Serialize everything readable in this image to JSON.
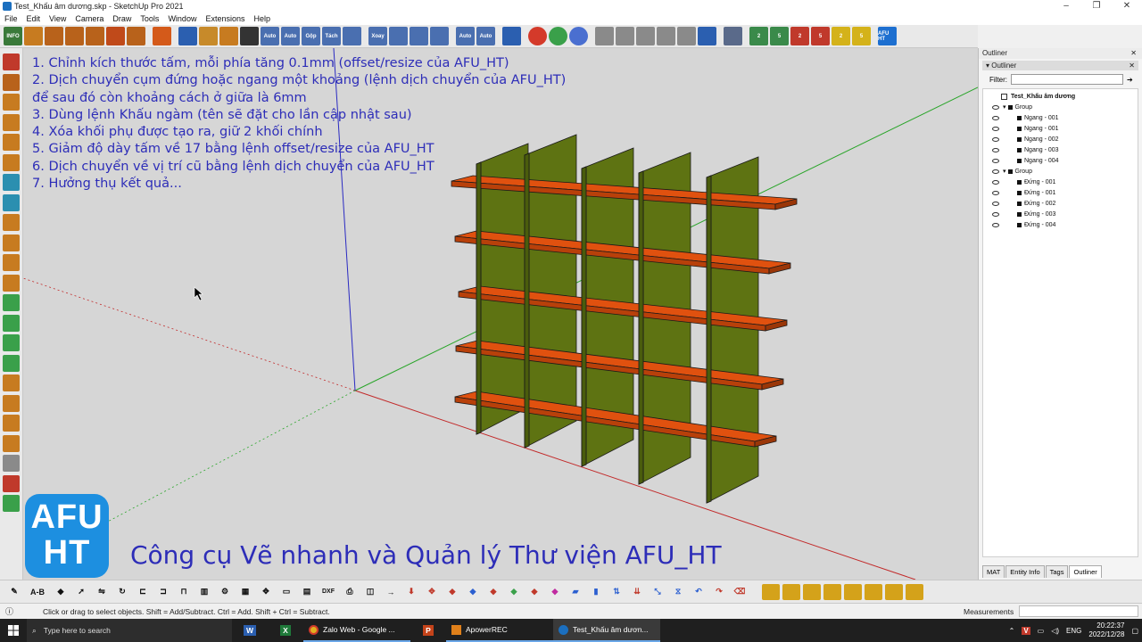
{
  "window": {
    "title": "Test_Khấu âm dương.skp - SketchUp Pro 2021",
    "controls": [
      "–",
      "❐",
      "✕"
    ]
  },
  "menu": [
    "File",
    "Edit",
    "View",
    "Camera",
    "Draw",
    "Tools",
    "Window",
    "Extensions",
    "Help"
  ],
  "toolbar_labels": {
    "info": "INFO",
    "auto1": "Auto",
    "auto2": "Auto",
    "gop": "Gộp",
    "tach": "Tách",
    "xoay": "Xoay",
    "auto3": "Auto",
    "auto4": "Auto",
    "afu": "AFU HT",
    "n2a": "2",
    "n5a": "5",
    "n2b": "2",
    "n5b": "5",
    "n2c": "2",
    "n5c": "5"
  },
  "colors": {
    "shelf": "#e0510f",
    "panel": "#5e7312",
    "instruction_text": "#2d2db8",
    "logo_bg": "#1d8fe0",
    "axis_red": "#c22a2a",
    "axis_green": "#2aa52a",
    "axis_blue": "#2a2ac2"
  },
  "instructions": [
    "1. Chỉnh kích thước tấm, mỗi phía tăng 0.1mm (offset/resize của AFU_HT)",
    "2. Dịch chuyển cụm đứng hoặc ngang một khoảng (lệnh dịch chuyển của AFU_HT)",
    "để sau đó còn khoảng cách ở giữa là 6mm",
    "3. Dùng lệnh Khấu ngàm (tên sẽ đặt cho lần cập nhật sau)",
    "4. Xóa khối phụ được tạo ra, giữ 2 khối chính",
    "5. Giảm độ dày tấm về 17 bằng lệnh offset/resize của AFU_HT",
    "6. Dịch chuyển về vị trí cũ bằng lệnh dịch chuyển của AFU_HT",
    "7. Hưởng thụ kết quả..."
  ],
  "logo": {
    "line1": "AFU",
    "line2": "HT"
  },
  "brand_title": "Công cụ Vẽ nhanh và Quản lý Thư viện AFU_HT",
  "outliner": {
    "panel_title": "Outliner",
    "section_title": "Outliner",
    "filter_label": "Filter:",
    "filter_value": "",
    "model_name": "Test_Khấu âm dương",
    "groups": [
      {
        "name": "Group",
        "children": [
          "Ngang - 001",
          "Ngang - 001",
          "Ngang - 002",
          "Ngang - 003",
          "Ngang - 004"
        ]
      },
      {
        "name": "Group",
        "children": [
          "Đứng - 001",
          "Đứng - 001",
          "Đứng - 002",
          "Đứng - 003",
          "Đứng - 004"
        ]
      }
    ],
    "tabs": [
      "MAT",
      "Entity Info",
      "Tags",
      "Outliner"
    ],
    "active_tab": "Outliner"
  },
  "bottom_toolbar": {
    "ab": "A-B",
    "dxf": "DXF"
  },
  "status": {
    "message": "Click or drag to select objects. Shift = Add/Subtract. Ctrl = Add. Shift + Ctrl = Subtract.",
    "measurements_label": "Measurements",
    "measurements_value": ""
  },
  "taskbar": {
    "search_placeholder": "Type here to search",
    "apps": [
      {
        "label": "Zalo Web - Google ...",
        "icon": "chrome-icon"
      },
      {
        "label": "ApowerREC",
        "icon": "apowerrec-icon"
      },
      {
        "label": "Test_Khấu âm dươn...",
        "icon": "sketchup-icon"
      }
    ],
    "language": "ENG",
    "time": "20:22:37",
    "date": "2022/12/28"
  }
}
